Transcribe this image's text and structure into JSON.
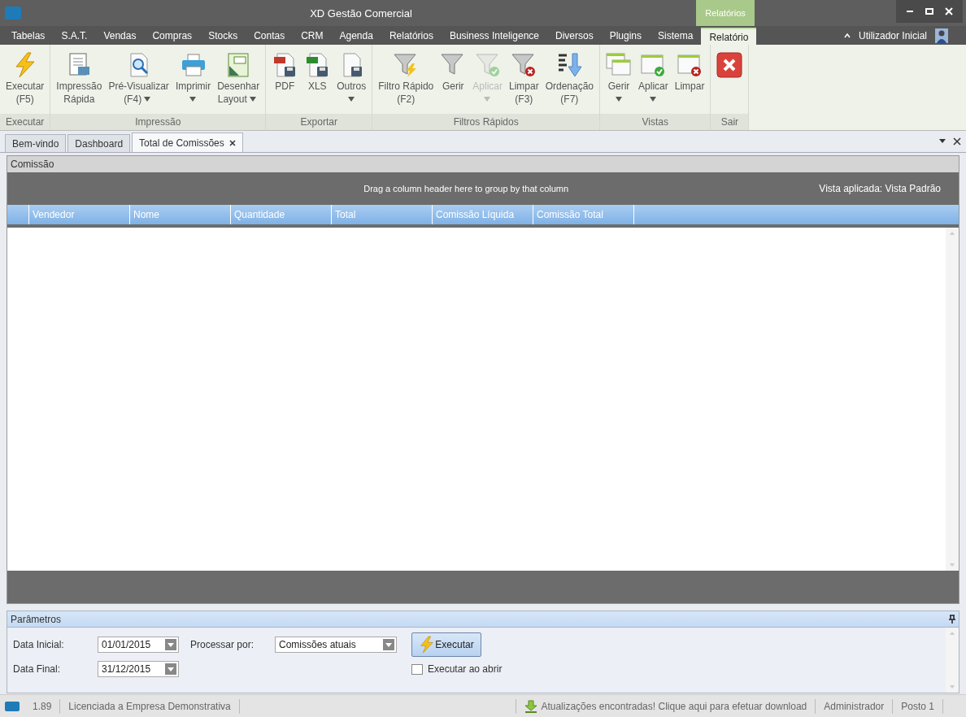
{
  "window": {
    "title": "XD Gestão Comercial"
  },
  "contextual_tab_group": "Relatórios",
  "menu": [
    {
      "label": "Tabelas",
      "selected": false
    },
    {
      "label": "S.A.T.",
      "selected": false
    },
    {
      "label": "Vendas",
      "selected": false
    },
    {
      "label": "Compras",
      "selected": false
    },
    {
      "label": "Stocks",
      "selected": false
    },
    {
      "label": "Contas",
      "selected": false
    },
    {
      "label": "CRM",
      "selected": false
    },
    {
      "label": "Agenda",
      "selected": false
    },
    {
      "label": "Relatórios",
      "selected": false
    },
    {
      "label": "Business Inteligence",
      "selected": false
    },
    {
      "label": "Diversos",
      "selected": false
    },
    {
      "label": "Plugins",
      "selected": false
    },
    {
      "label": "Sistema",
      "selected": false
    },
    {
      "label": "Relatório",
      "selected": true
    }
  ],
  "user": {
    "name": "Utilizador Inicial"
  },
  "ribbon": [
    {
      "label": "Executar",
      "buttons": [
        {
          "lines": [
            "Executar",
            "(F5)"
          ],
          "dropdown": false,
          "disabled": false
        }
      ]
    },
    {
      "label": "Impressão",
      "buttons": [
        {
          "lines": [
            "Impressão",
            "Rápida"
          ],
          "dropdown": false,
          "disabled": false
        },
        {
          "lines": [
            "Pré-Visualizar",
            "(F4)"
          ],
          "dropdown": true,
          "disabled": false
        },
        {
          "lines": [
            "Imprimir"
          ],
          "dropdown": true,
          "disabled": false
        },
        {
          "lines": [
            "Desenhar",
            "Layout"
          ],
          "dropdown": true,
          "disabled": false
        }
      ]
    },
    {
      "label": "Exportar",
      "buttons": [
        {
          "lines": [
            "PDF"
          ],
          "dropdown": false,
          "disabled": false
        },
        {
          "lines": [
            "XLS"
          ],
          "dropdown": false,
          "disabled": false
        },
        {
          "lines": [
            "Outros"
          ],
          "dropdown": true,
          "disabled": false
        }
      ]
    },
    {
      "label": "Filtros Rápidos",
      "buttons": [
        {
          "lines": [
            "Filtro Rápido",
            "(F2)"
          ],
          "dropdown": false,
          "disabled": false
        },
        {
          "lines": [
            "Gerir"
          ],
          "dropdown": false,
          "disabled": false
        },
        {
          "lines": [
            "Aplicar"
          ],
          "dropdown": true,
          "disabled": true
        },
        {
          "lines": [
            "Limpar",
            "(F3)"
          ],
          "dropdown": false,
          "disabled": false
        },
        {
          "lines": [
            "Ordenação",
            "(F7)"
          ],
          "dropdown": false,
          "disabled": false
        }
      ]
    },
    {
      "label": "Vistas",
      "buttons": [
        {
          "lines": [
            "Gerir"
          ],
          "dropdown": true,
          "disabled": false
        },
        {
          "lines": [
            "Aplicar"
          ],
          "dropdown": true,
          "disabled": false
        },
        {
          "lines": [
            "Limpar"
          ],
          "dropdown": false,
          "disabled": false
        }
      ]
    },
    {
      "label": "Sair",
      "buttons": [
        {
          "disabled": false
        }
      ]
    }
  ],
  "doc_tabs": [
    {
      "label": "Bem-vindo",
      "selected": false,
      "closable": false
    },
    {
      "label": "Dashboard",
      "selected": false,
      "closable": false
    },
    {
      "label": "Total de Comissões",
      "selected": true,
      "closable": true
    }
  ],
  "panel": {
    "title": "Comissão",
    "group_hint": "Drag a column header here to group by that column",
    "view_label": "Vista aplicada: Vista Padrão"
  },
  "table": {
    "columns": [
      "Vendedor",
      "Nome",
      "Quantidade",
      "Total",
      "Comissão Líquida",
      "Comissão Total"
    ]
  },
  "parameters": {
    "title": "Parâmetros",
    "fields": [
      {
        "label": "Data Inicial:",
        "value": "01/01/2015"
      },
      {
        "label": "Data Final:",
        "value": "31/12/2015"
      }
    ],
    "process": {
      "label": "Processar por:",
      "value": "Comissões atuais"
    },
    "button": "Executar",
    "checkbox": {
      "label": "Executar ao abrir",
      "checked": false
    }
  },
  "status_bar": {
    "version": "1.89",
    "license": "Licenciada a Empresa Demonstrativa",
    "update": "Atualizações encontradas! Clique aqui para efetuar download",
    "user": "Administrador",
    "station": "Posto 1"
  }
}
